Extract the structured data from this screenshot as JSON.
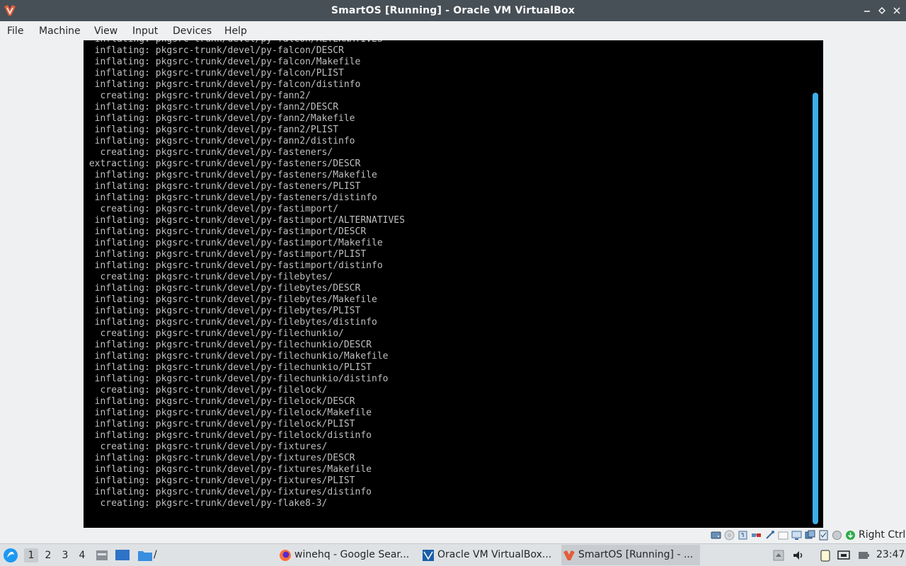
{
  "window": {
    "title": "SmartOS [Running] - Oracle VM VirtualBox",
    "controls": [
      "minimize-icon",
      "maximize-icon",
      "close-icon"
    ]
  },
  "menubar": {
    "items": [
      "File",
      "Machine",
      "View",
      "Input",
      "Devices",
      "Help"
    ]
  },
  "console": {
    "lines": [
      "  inflating: pkgsrc-trunk/devel/py-falcon/ALTERNATIVES",
      "  inflating: pkgsrc-trunk/devel/py-falcon/DESCR",
      "  inflating: pkgsrc-trunk/devel/py-falcon/Makefile",
      "  inflating: pkgsrc-trunk/devel/py-falcon/PLIST",
      "  inflating: pkgsrc-trunk/devel/py-falcon/distinfo",
      "   creating: pkgsrc-trunk/devel/py-fann2/",
      "  inflating: pkgsrc-trunk/devel/py-fann2/DESCR",
      "  inflating: pkgsrc-trunk/devel/py-fann2/Makefile",
      "  inflating: pkgsrc-trunk/devel/py-fann2/PLIST",
      "  inflating: pkgsrc-trunk/devel/py-fann2/distinfo",
      "   creating: pkgsrc-trunk/devel/py-fasteners/",
      " extracting: pkgsrc-trunk/devel/py-fasteners/DESCR",
      "  inflating: pkgsrc-trunk/devel/py-fasteners/Makefile",
      "  inflating: pkgsrc-trunk/devel/py-fasteners/PLIST",
      "  inflating: pkgsrc-trunk/devel/py-fasteners/distinfo",
      "   creating: pkgsrc-trunk/devel/py-fastimport/",
      "  inflating: pkgsrc-trunk/devel/py-fastimport/ALTERNATIVES",
      "  inflating: pkgsrc-trunk/devel/py-fastimport/DESCR",
      "  inflating: pkgsrc-trunk/devel/py-fastimport/Makefile",
      "  inflating: pkgsrc-trunk/devel/py-fastimport/PLIST",
      "  inflating: pkgsrc-trunk/devel/py-fastimport/distinfo",
      "   creating: pkgsrc-trunk/devel/py-filebytes/",
      "  inflating: pkgsrc-trunk/devel/py-filebytes/DESCR",
      "  inflating: pkgsrc-trunk/devel/py-filebytes/Makefile",
      "  inflating: pkgsrc-trunk/devel/py-filebytes/PLIST",
      "  inflating: pkgsrc-trunk/devel/py-filebytes/distinfo",
      "   creating: pkgsrc-trunk/devel/py-filechunkio/",
      "  inflating: pkgsrc-trunk/devel/py-filechunkio/DESCR",
      "  inflating: pkgsrc-trunk/devel/py-filechunkio/Makefile",
      "  inflating: pkgsrc-trunk/devel/py-filechunkio/PLIST",
      "  inflating: pkgsrc-trunk/devel/py-filechunkio/distinfo",
      "   creating: pkgsrc-trunk/devel/py-filelock/",
      "  inflating: pkgsrc-trunk/devel/py-filelock/DESCR",
      "  inflating: pkgsrc-trunk/devel/py-filelock/Makefile",
      "  inflating: pkgsrc-trunk/devel/py-filelock/PLIST",
      "  inflating: pkgsrc-trunk/devel/py-filelock/distinfo",
      "   creating: pkgsrc-trunk/devel/py-fixtures/",
      "  inflating: pkgsrc-trunk/devel/py-fixtures/DESCR",
      "  inflating: pkgsrc-trunk/devel/py-fixtures/Makefile",
      "  inflating: pkgsrc-trunk/devel/py-fixtures/PLIST",
      "  inflating: pkgsrc-trunk/devel/py-fixtures/distinfo",
      "   creating: pkgsrc-trunk/devel/py-flake8-3/"
    ]
  },
  "vbox_status": {
    "icons": [
      "hard-disk-icon",
      "optical-disk-icon",
      "audio-icon",
      "network-icon",
      "usb-icon",
      "shared-folder-icon",
      "display-icon",
      "video-capture-icon",
      "cpu-icon",
      "mouse-integration-icon",
      "keyboard-capture-icon"
    ],
    "host_key": "Right Ctrl"
  },
  "taskbar": {
    "workspaces": [
      "1",
      "2",
      "3",
      "4"
    ],
    "launchers": [
      "app-menu-icon",
      "file-manager-icon",
      "show-desktop-icon",
      "folder-icon"
    ],
    "launcher_text": "/",
    "tasks": [
      {
        "label": "winehq - Google Sear...",
        "icon": "firefox-icon"
      },
      {
        "label": "Oracle VM VirtualBox...",
        "icon": "virtualbox-icon"
      },
      {
        "label": "SmartOS [Running] - ...",
        "icon": "vm-running-icon"
      }
    ],
    "tray": [
      "updates-icon",
      "volume-icon",
      "clipboard-icon",
      "network-icon",
      "battery-icon"
    ],
    "clock": "23:47"
  },
  "colors": {
    "titlebar": "#475057",
    "accent": "#3daee9",
    "console_bg": "#000000",
    "console_text": "#bfbfbf"
  }
}
